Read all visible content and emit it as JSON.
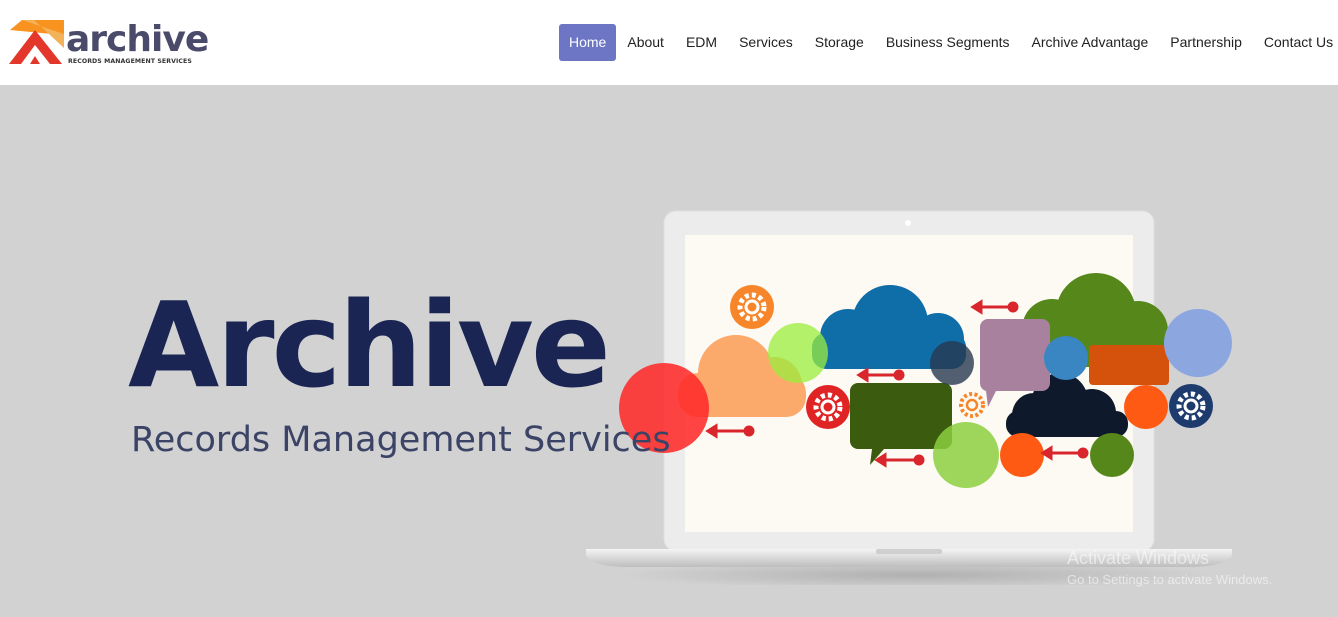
{
  "brand": {
    "name": "archive",
    "tagline": "RECORDS MANAGEMENT SERVICES"
  },
  "nav": {
    "items": [
      {
        "label": "Home",
        "active": true
      },
      {
        "label": "About"
      },
      {
        "label": "EDM"
      },
      {
        "label": "Services"
      },
      {
        "label": "Storage"
      },
      {
        "label": "Business Segments"
      },
      {
        "label": "Archive Advantage"
      },
      {
        "label": "Partnership"
      },
      {
        "label": "Contact Us"
      }
    ]
  },
  "hero": {
    "title": "Archive",
    "subtitle": "Records Management Services",
    "illustration": "laptop-cloud-illustration"
  },
  "watermark": {
    "line1": "Activate Windows",
    "line2": "Go to Settings to activate Windows."
  },
  "colors": {
    "nav_active": "#6c76c4",
    "hero_title": "#1b2553",
    "hero_background": "#d2d2d2",
    "logo_orange": "#f7931e",
    "logo_red": "#e2372a"
  }
}
